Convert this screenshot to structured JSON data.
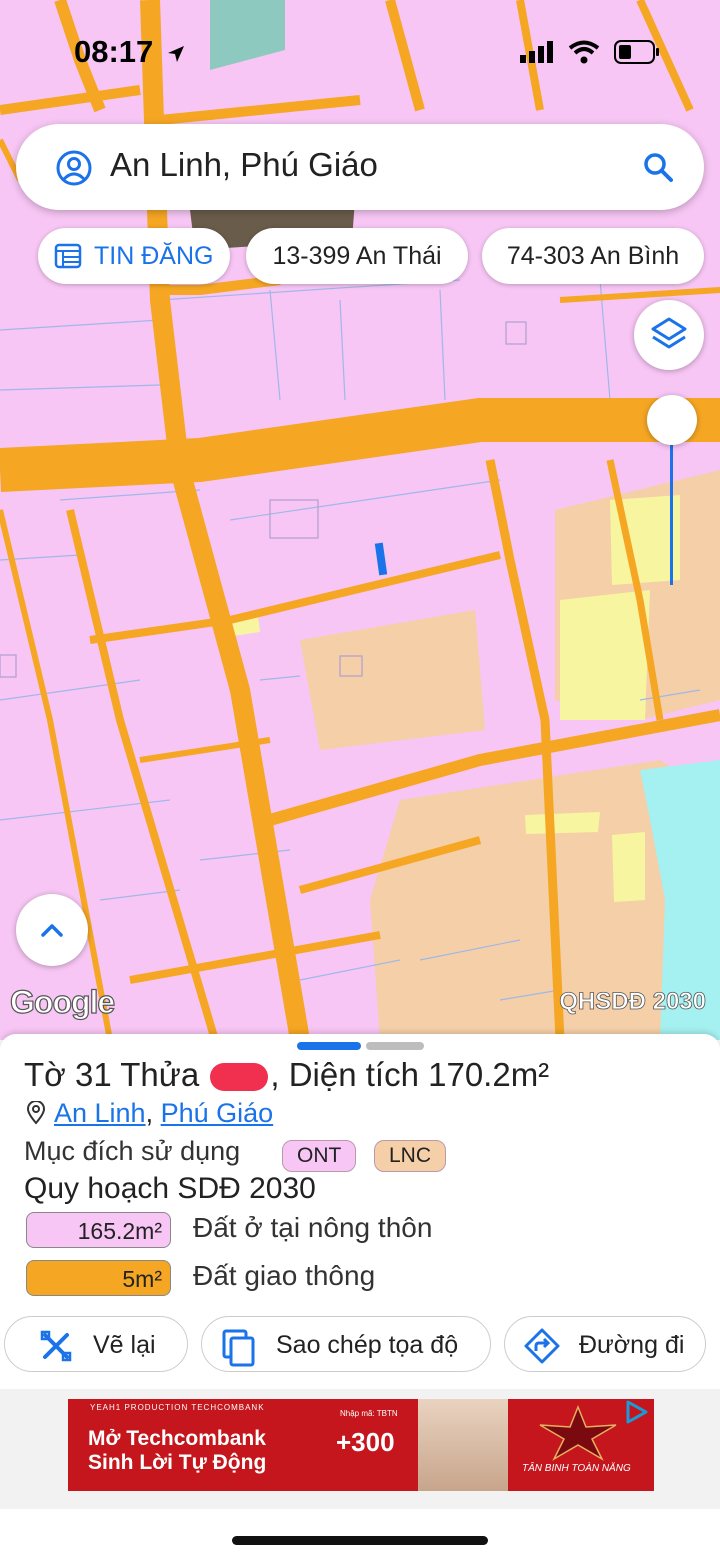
{
  "status_bar": {
    "time": "08:17"
  },
  "search": {
    "query": "An Linh, Phú Giáo"
  },
  "chips": [
    {
      "label": "TIN ĐĂNG"
    },
    {
      "label": "13-399 An Thái"
    },
    {
      "label": "74-303 An Bình"
    }
  ],
  "map": {
    "attribution": "Google",
    "overlay_label": "QHSDĐ 2030"
  },
  "parcel": {
    "title_prefix": "Tờ 31 Thửa",
    "title_suffix": ", Diện tích 170.2m²",
    "location": {
      "ward": "An Linh",
      "separator": ",",
      "district": "Phú Giáo"
    },
    "purpose_label": "Mục đích sử dụng",
    "purpose_codes": [
      "ONT",
      "LNC"
    ],
    "plan_title": "Quy hoạch SDĐ 2030",
    "plan_items": [
      {
        "area": "165.2m²",
        "description": "Đất ở tại nông thôn",
        "color": "#f7c6f4"
      },
      {
        "area": "5m²",
        "description": "Đất giao thông",
        "color": "#f5a623"
      }
    ]
  },
  "actions": [
    {
      "label": "Vẽ lại"
    },
    {
      "label": "Sao chép tọa độ"
    },
    {
      "label": "Đường đi"
    }
  ],
  "ad": {
    "top_line": "YEAH1 PRODUCTION TECHCOMBANK",
    "headline_1": "Mở Techcombank",
    "headline_2": "Sinh Lời Tự Động",
    "promo_code": "Nhập mã: TBTN",
    "promo_value": "+300",
    "brand": "TÂN BINH TOÀN NĂNG"
  },
  "colors": {
    "residential": "#f7c6f4",
    "road": "#f5a623",
    "agricultural": "#f5cfa8",
    "yellow_zone": "#f8f5a0",
    "water": "#a5f0f0",
    "accent": "#1a73e8"
  }
}
